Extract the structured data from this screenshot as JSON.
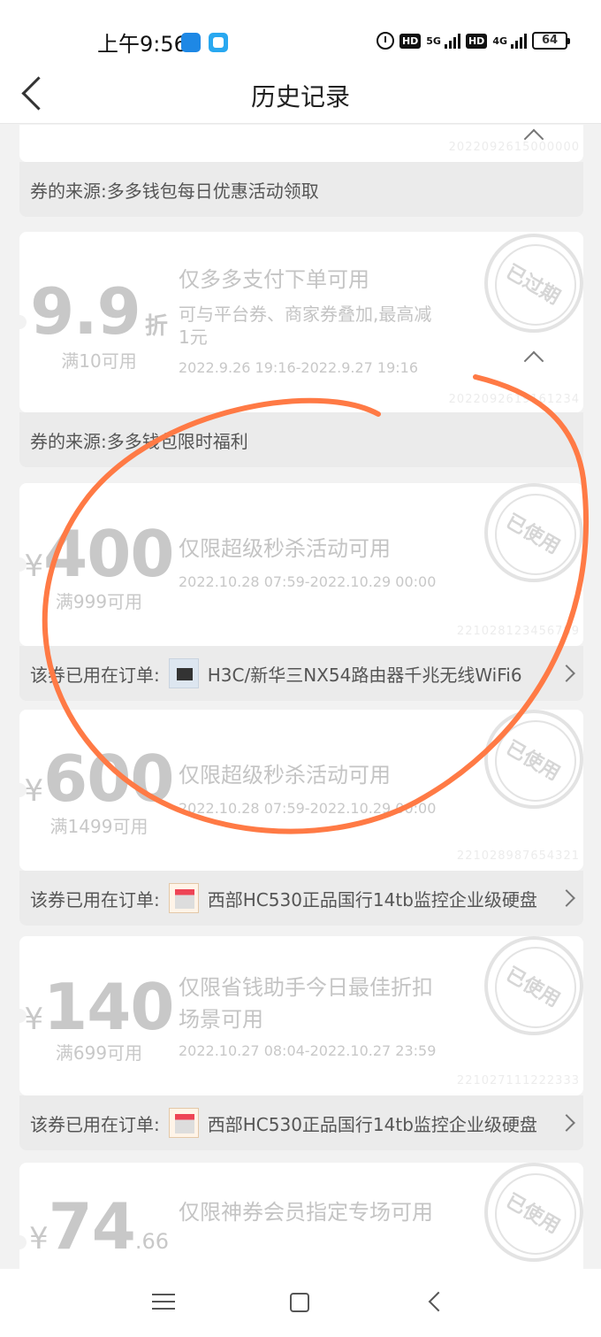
{
  "status": {
    "time": "上午9:56",
    "net1": "5G",
    "net2": "4G",
    "battery": "64"
  },
  "nav": {
    "title": "历史记录"
  },
  "coupons": [
    {
      "footer_label": "券的来源:",
      "footer_text": "多多钱包每日优惠活动领取",
      "code": "2022092615000000"
    },
    {
      "amount": "9.9",
      "unit": "折",
      "threshold": "满10可用",
      "title": "仅多多支付下单可用",
      "desc": "可与平台券、商家券叠加,最高减1元",
      "period": "2022.9.26 19:16-2022.9.27 19:16",
      "stamp": "已过期",
      "footer_label": "券的来源:",
      "footer_text": "多多钱包限时福利",
      "code": "2022092619161234"
    },
    {
      "currency": "¥",
      "amount": "400",
      "threshold": "满999可用",
      "title": "仅限超级秒杀活动可用",
      "period": "2022.10.28 07:59-2022.10.29 00:00",
      "stamp": "已使用",
      "footer_label": "该券已用在订单:",
      "footer_text": "H3C/新华三NX54路由器千兆无线WiFi6",
      "code": "221028123456789"
    },
    {
      "currency": "¥",
      "amount": "600",
      "threshold": "满1499可用",
      "title": "仅限超级秒杀活动可用",
      "period": "2022.10.28 07:59-2022.10.29 00:00",
      "stamp": "已使用",
      "footer_label": "该券已用在订单:",
      "footer_text": "西部HC530正品国行14tb监控企业级硬盘",
      "code": "221028987654321"
    },
    {
      "currency": "¥",
      "amount": "140",
      "threshold": "满699可用",
      "title": "仅限省钱助手今日最佳折扣场景可用",
      "period": "2022.10.27 08:04-2022.10.27 23:59",
      "stamp": "已使用",
      "footer_label": "该券已用在订单:",
      "footer_text": "西部HC530正品国行14tb监控企业级硬盘",
      "code": "221027111222333"
    },
    {
      "currency": "¥",
      "amount": "74",
      "decimal": ".66",
      "title": "仅限神券会员指定专场可用",
      "stamp": "已使用"
    }
  ],
  "colors": {
    "accent_scribble": "#ff7a45",
    "disabled_text": "#c8c8c8"
  }
}
